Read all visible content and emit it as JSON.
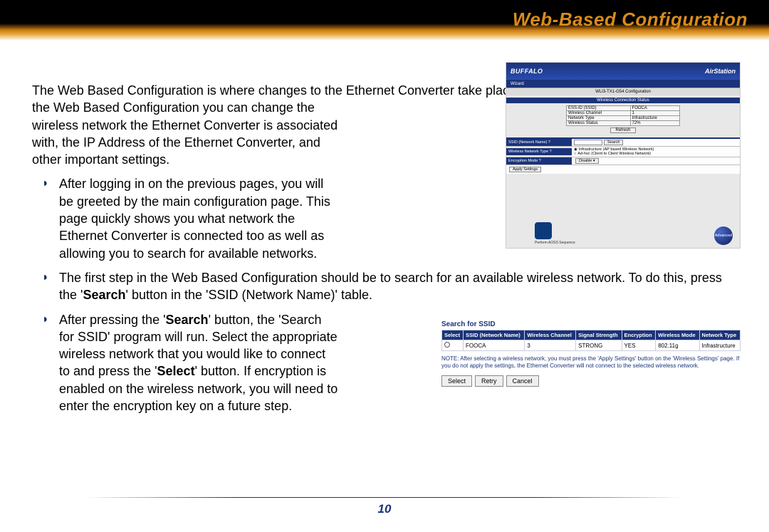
{
  "header": {
    "title": "Web-Based Configuration"
  },
  "intro": {
    "full": "The Web Based Configuration is where changes to the Ethernet Converter take place.  Through",
    "narrow": "the Web Based Configuration you can change the wireless network the Ethernet Converter is associated with, the IP Address of the Ethernet Converter, and other important settings."
  },
  "bullets": {
    "b1": "After logging in on the previous pages, you will be greeted by the main configuration page.  This page quickly shows you what network the Ethernet Converter is connected too as well as allowing you to search for available networks.",
    "b2_pre": "The first step in the Web Based Configuration should be to search for an available wireless network.  To do this, press the '",
    "b2_bold": "Search",
    "b2_post": "' button in the 'SSID (Network Name)' table.",
    "b3_pre": "After pressing the '",
    "b3_bold1": "Search",
    "b3_mid": "' button, the 'Search for SSID' program will run.  Select the appropriate wireless network that you would like to connect to and press the '",
    "b3_bold2": "Select",
    "b3_post": "' button.  If encryption is enabled on the wireless network, you will need to enter the encryption key on a future step."
  },
  "figure1": {
    "brand": "BUFFALO",
    "airstation": "AirStation",
    "wizard": "Wizard",
    "model": "WLI3-TX1-G54 Configuration",
    "status_title": "Wireless Connection Status",
    "status_rows": [
      [
        "ESS-ID (SSID)",
        "FOOCA"
      ],
      [
        "Wireless Channel",
        "1"
      ],
      [
        "Network Type",
        "Infrastructure"
      ],
      [
        "Wireless Status",
        "72%"
      ]
    ],
    "refresh": "Refresh",
    "ssid_label": "SSID (Network Name) ?",
    "search": "Search",
    "wnt_label": "Wireless Network Type ?",
    "wnt_opt1": "Infrastructure (AP based Wireless Network)",
    "wnt_opt2": "Ad-hoc (Client to Client Wireless Network)",
    "enc_label": "Encryption Mode ?",
    "enc_value": "Disable",
    "apply": "Apply Settings",
    "aoss_caption": "Perform AOSS Sequence",
    "advanced": "Advanced"
  },
  "figure2": {
    "title": "Search for SSID",
    "headers": [
      "Select",
      "SSID (Network Name)",
      "Wireless Channel",
      "Signal Strength",
      "Encryption",
      "Wireless Mode",
      "Network Type"
    ],
    "row": [
      "",
      "FOOCA",
      "3",
      "STRONG",
      "YES",
      "802.11g",
      "Infrastructure"
    ],
    "note": "NOTE: After selecting a wireless network, you must press the 'Apply Settings' button on the 'Wireless Settings' page. If you do not apply the settings, the Ethernet Converter will not connect to the selected wireless network.",
    "buttons": {
      "select": "Select",
      "retry": "Retry",
      "cancel": "Cancel"
    }
  },
  "footer": {
    "page": "10"
  }
}
